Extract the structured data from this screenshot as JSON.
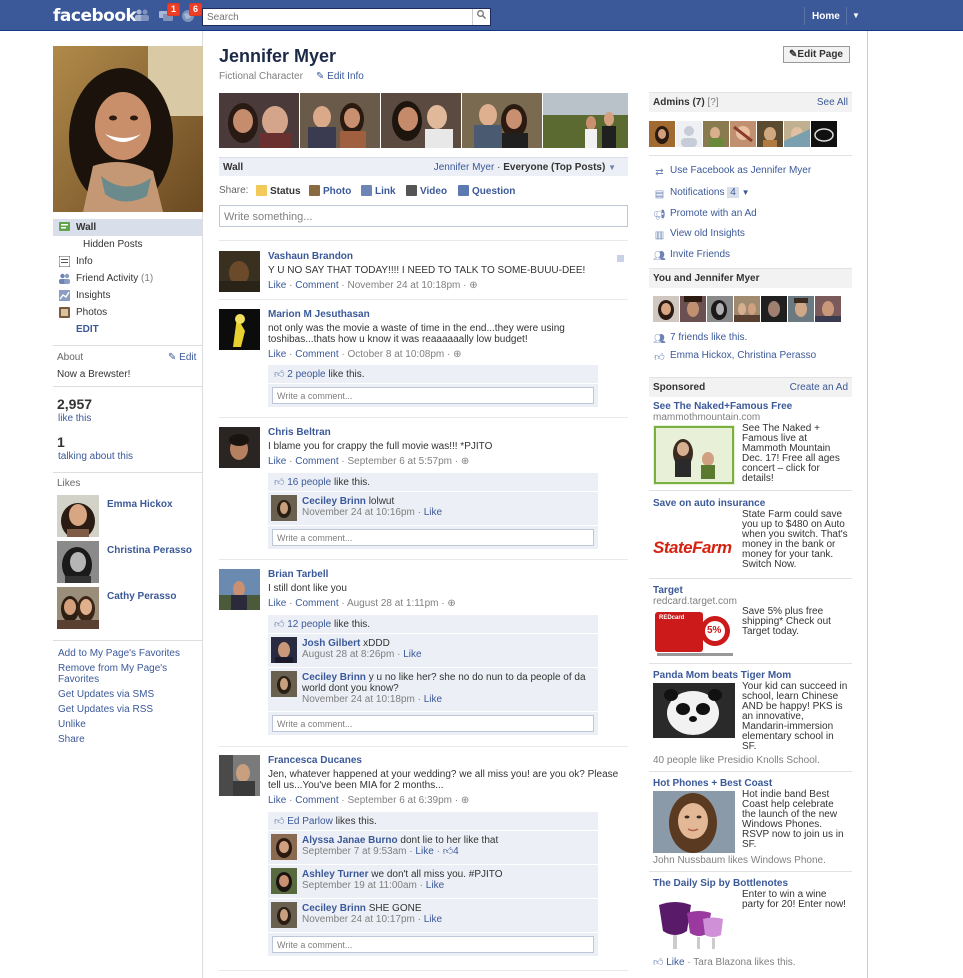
{
  "topbar": {
    "logo": "facebook",
    "friend_badge": "1",
    "notif_badge": "6",
    "search_placeholder": "Search",
    "home": "Home"
  },
  "left": {
    "nav": [
      {
        "label": "Wall",
        "selected": true,
        "icon": "wall-icon"
      },
      {
        "label": "Hidden Posts",
        "icon": ""
      },
      {
        "label": "Info",
        "icon": "info-icon"
      },
      {
        "label": "Friend Activity",
        "count": "(1)",
        "icon": "friend-activity-icon"
      },
      {
        "label": "Insights",
        "icon": "insights-icon"
      },
      {
        "label": "Photos",
        "icon": "photos-icon"
      }
    ],
    "edit": "EDIT",
    "about_title": "About",
    "about_edit": "Edit",
    "about_text": "Now a Brewster!",
    "like_count": "2,957",
    "like_label": "like this",
    "talking_count": "1",
    "talking_label": "talking about this",
    "likes_title": "Likes",
    "likes": [
      "Emma Hickox",
      "Christina Perasso",
      "Cathy Perasso"
    ],
    "links": [
      "Add to My Page's Favorites",
      "Remove from My Page's Favorites",
      "Get Updates via SMS",
      "Get Updates via RSS",
      "Unlike",
      "Share"
    ]
  },
  "main": {
    "name": "Jennifer Myer",
    "category": "Fictional Character",
    "edit_info": "Edit Info",
    "edit_page": "Edit Page",
    "wall_title": "Wall",
    "wall_filter_name": "Jennifer Myer",
    "wall_filter_sep": "·",
    "wall_filter": "Everyone (Top Posts)",
    "share_label": "Share:",
    "share": [
      "Status",
      "Photo",
      "Link",
      "Video",
      "Question"
    ],
    "composer_placeholder": "Write something...",
    "write_comment": "Write a comment...",
    "like": "Like",
    "comment": "Comment",
    "posts": [
      {
        "author": "Vashaun Brandon",
        "text": "Y U NO SAY THAT TODAY!!!! I NEED TO TALK TO SOME-BUUU-DEE!",
        "time": "November 24 at 10:18pm"
      },
      {
        "author": "Marion M Jesuthasan",
        "text": "not only was the movie a waste of time in the end...they were using toshibas...thats how u know it was reaaaaaally low budget!",
        "time": "October 8 at 10:08pm",
        "likes": "2 people",
        "likes_suffix": "like this."
      },
      {
        "author": "Chris Beltran",
        "text": "I blame you for crappy the full movie was!!! *PJITO",
        "time": "September 6 at 5:57pm",
        "likes": "16 people",
        "likes_suffix": "like this.",
        "comments": [
          {
            "author": "Ceciley Brinn",
            "text": "lolwut",
            "time": "November 24 at 10:16pm",
            "like": "Like"
          }
        ]
      },
      {
        "author": "Brian Tarbell",
        "text": "I still dont like you",
        "time": "August 28 at 1:11pm",
        "likes": "12 people",
        "likes_suffix": "like this.",
        "comments": [
          {
            "author": "Josh Gilbert",
            "text": "xDDD",
            "time": "August 28 at 8:26pm",
            "like": "Like"
          },
          {
            "author": "Ceciley Brinn",
            "text": "y u no like her? she no do nun to da people of da world dont you know?",
            "time": "November 24 at 10:18pm",
            "like": "Like"
          }
        ]
      },
      {
        "author": "Francesca Ducanes",
        "text": "Jen, whatever happened at your wedding? we all miss you! are you ok? Please tell us...You've been MIA for 2 months...",
        "time": "September 6 at 6:39pm",
        "likes": "Ed Parlow",
        "likes_suffix": "likes this.",
        "comments": [
          {
            "author": "Alyssa Janae Burno",
            "text": "dont lie to her like that",
            "time": "September 7 at 9:53am",
            "like": "Like",
            "like_count": "4"
          },
          {
            "author": "Ashley Turner",
            "text": "we don't all miss you. #PJITO",
            "time": "September 19 at 11:00am",
            "like": "Like"
          },
          {
            "author": "Ceciley Brinn",
            "text": "SHE GONE",
            "time": "November 24 at 10:17pm",
            "like": "Like"
          }
        ]
      }
    ]
  },
  "right": {
    "admins_title": "Admins (7)",
    "admins_help": "[?]",
    "see_all": "See All",
    "actions": [
      {
        "label": "Use Facebook as Jennifer Myer",
        "icon": "switch-user-icon"
      },
      {
        "label": "Notifications",
        "badge": "4",
        "icon": "notifications-icon"
      },
      {
        "label": "Promote with an Ad",
        "icon": "megaphone-icon"
      },
      {
        "label": "View old Insights",
        "icon": "insights-icon"
      },
      {
        "label": "Invite Friends",
        "icon": "invite-friends-icon"
      }
    ],
    "you_and": "You and Jennifer Myer",
    "friends_like": "7 friends like this.",
    "friends_names": "Emma Hickox, Christina Perasso",
    "sponsored": "Sponsored",
    "create_ad": "Create an Ad",
    "ads": [
      {
        "title": "See The Naked+Famous Free",
        "url": "mammothmountain.com",
        "body": "See The Naked + Famous live at Mammoth Mountain Dec. 17! Free all ages concert – click for details!"
      },
      {
        "title": "Save on auto insurance",
        "url": "",
        "body": "State Farm could save you up to $480 on Auto when you switch. That's money in the bank or money for your tank. Switch Now.",
        "logo": "StateFarm"
      },
      {
        "title": "Target",
        "url": "redcard.target.com",
        "body": "Save 5% plus free shipping* Check out Target today.",
        "card": "REDcard",
        "pct": "5%"
      },
      {
        "title": "Panda Mom beats Tiger Mom",
        "url": "",
        "body": "Your kid can succeed in school, learn Chinese AND be happy! PKS is an innovative, Mandarin-immersion elementary school in SF.",
        "footer": "40 people like Presidio Knolls School."
      },
      {
        "title": "Hot Phones + Best Coast",
        "url": "",
        "body": "Hot indie band Best Coast help celebrate the launch of the new Windows Phones. RSVP now to join us in SF.",
        "footer": "John Nussbaum likes Windows Phone."
      },
      {
        "title": "The Daily Sip by Bottlenotes",
        "url": "",
        "body": "Enter to win a wine party for 20! Enter now!",
        "footer_like": "Like",
        "footer": "· Tara Blazona likes this."
      }
    ]
  }
}
